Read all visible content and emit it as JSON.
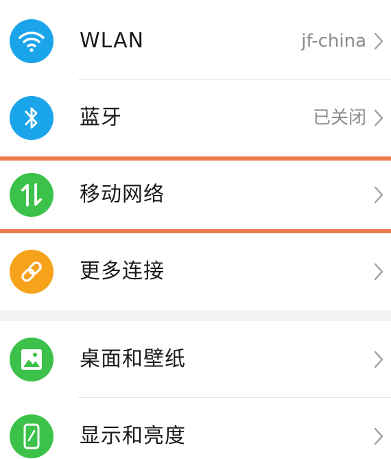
{
  "settings": {
    "groups": [
      {
        "items": [
          {
            "label": "WLAN",
            "value": "jf-china",
            "icon": "wifi-icon",
            "icon_color": "#1aa4ea"
          },
          {
            "label": "蓝牙",
            "value": "已关闭",
            "icon": "bluetooth-icon",
            "icon_color": "#1aa4ea"
          },
          {
            "label": "移动网络",
            "value": "",
            "icon": "mobile-data-icon",
            "icon_color": "#3cc24a"
          },
          {
            "label": "更多连接",
            "value": "",
            "icon": "link-icon",
            "icon_color": "#f7a21b"
          }
        ]
      },
      {
        "items": [
          {
            "label": "桌面和壁纸",
            "value": "",
            "icon": "image-icon",
            "icon_color": "#3cc24a"
          },
          {
            "label": "显示和亮度",
            "value": "",
            "icon": "phone-display-icon",
            "icon_color": "#3cc24a"
          }
        ]
      }
    ]
  },
  "colors": {
    "highlight_border": "#ef7a4c",
    "label": "#1a1a1a",
    "value": "#8a8a8a",
    "chevron": "#9e9e9e"
  }
}
